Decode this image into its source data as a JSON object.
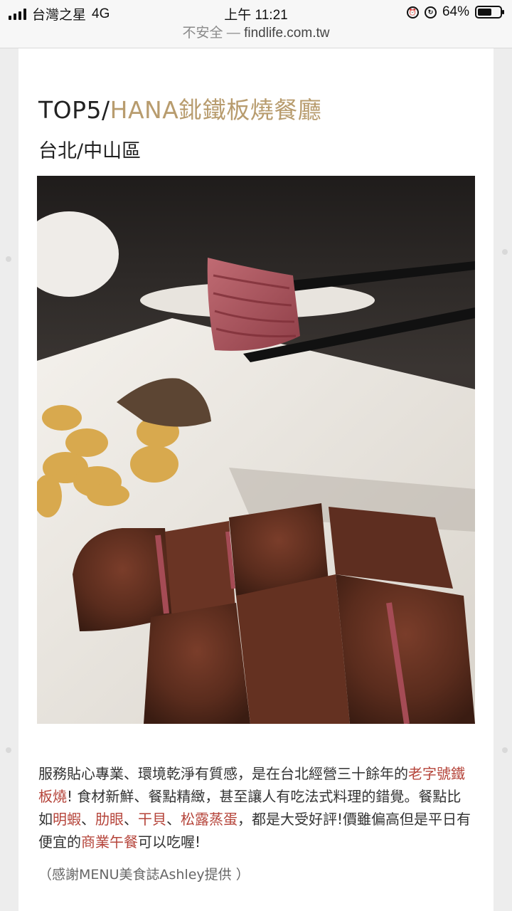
{
  "status_bar": {
    "carrier": "台灣之星",
    "network": "4G",
    "time": "上午 11:21",
    "battery": "64%",
    "battery_level": 0.64
  },
  "url_bar": {
    "security": "不安全",
    "separator": " — ",
    "domain": "findlife.com.tw"
  },
  "article": {
    "title_prefix": "TOP5/",
    "title_name": "HANA鉳鐵板燒餐廳",
    "subtitle": "台北/中山區",
    "paragraph": [
      {
        "text": "服務貼心專業、環境乾淨有質感，是在台北經營三十餘年的",
        "highlight": false
      },
      {
        "text": "老字號鐵板燒",
        "highlight": true
      },
      {
        "text": "! 食材新鮮、餐點精緻，甚至讓人有吃法式料理的錯覺。餐點比如",
        "highlight": false
      },
      {
        "text": "明蝦",
        "highlight": true
      },
      {
        "text": "、",
        "highlight": false
      },
      {
        "text": "肋眼",
        "highlight": true
      },
      {
        "text": "、",
        "highlight": false
      },
      {
        "text": "干貝",
        "highlight": true
      },
      {
        "text": "、",
        "highlight": false
      },
      {
        "text": "松露蒸蛋",
        "highlight": true
      },
      {
        "text": "，都是大受好評!價雖偏高但是平日有便宜的",
        "highlight": false
      },
      {
        "text": "商業午餐",
        "highlight": true
      },
      {
        "text": "可以吃喔!",
        "highlight": false
      }
    ],
    "credit": "（感謝MENU美食誌Ashley提供 ）"
  },
  "colors": {
    "accent_gold": "#b89c6e",
    "highlight_red": "#b5443a"
  },
  "icons": [
    "signal-icon",
    "alarm-icon",
    "orientation-lock-icon",
    "battery-icon"
  ]
}
